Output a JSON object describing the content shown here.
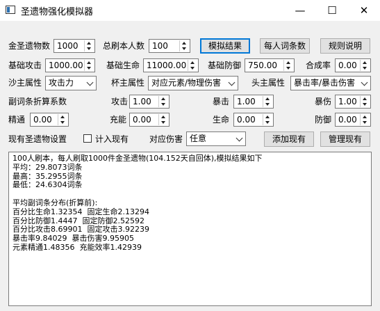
{
  "window": {
    "title": "圣遗物强化模拟器",
    "minimize": "—",
    "maximize": "☐",
    "close": "✕"
  },
  "row1": {
    "count_label": "金圣遗物数",
    "count_value": "1000",
    "people_label": "总刷本人数",
    "people_value": "100",
    "simulate_button": "模拟结果",
    "per_person_button": "每人词条数",
    "rules_button": "规则说明"
  },
  "row2": {
    "atk_label": "基础攻击",
    "atk_value": "1000.00",
    "hp_label": "基础生命",
    "hp_value": "11000.00",
    "def_label": "基础防御",
    "def_value": "750.00",
    "synth_label": "合成率",
    "synth_value": "0.00"
  },
  "row3": {
    "sands_label": "沙主属性",
    "sands_value": "攻击力",
    "goblet_label": "杯主属性",
    "goblet_value": "对应元素/物理伤害",
    "circlet_label": "头主属性",
    "circlet_value": "暴击率/暴击伤害"
  },
  "weights": {
    "title": "副词条折算系数",
    "atk_label": "攻击",
    "atk_value": "1.00",
    "crit_label": "暴击",
    "crit_value": "1.00",
    "critdmg_label": "暴伤",
    "critdmg_value": "1.00",
    "em_label": "精通",
    "em_value": "0.00",
    "er_label": "充能",
    "er_value": "0.00",
    "hp_label": "生命",
    "hp_value": "0.00",
    "def_label": "防御",
    "def_value": "0.00"
  },
  "current": {
    "label": "现有圣遗物设置",
    "include_label": "计入现有",
    "include_checked": false,
    "bonus_label": "对应伤害",
    "bonus_value": "任意",
    "add_button": "添加现有",
    "manage_button": "管理现有"
  },
  "output_lines": [
    "100人刷本，每人刷取1000件金圣遗物(104.152天自回体),模拟结果如下",
    "平均：29.8073词条",
    "最高：35.2955词条",
    "最低：24.6304词条",
    "",
    "平均副词条分布(折算前):",
    "百分比生命1.32354  固定生命2.13294",
    "百分比防御1.4447  固定防御2.52592",
    "百分比攻击8.69901  固定攻击3.92239",
    "暴击率9.84029  暴击伤害9.95905",
    "元素精通1.48356  充能效率1.42939"
  ]
}
